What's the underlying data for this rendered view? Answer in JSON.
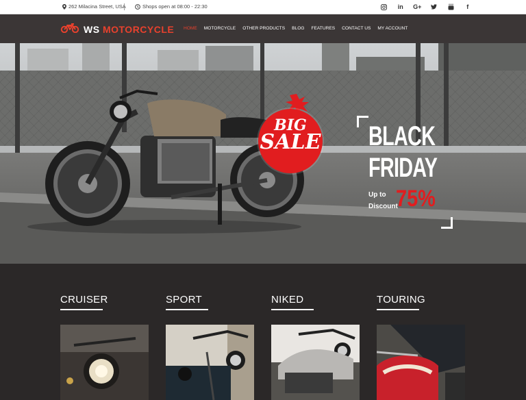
{
  "topbar": {
    "address": "262 Milacina Street, USA",
    "hours": "Shops open at 08:00 - 22:30",
    "socials": [
      {
        "name": "instagram",
        "glyph": "◎"
      },
      {
        "name": "linkedin",
        "glyph": "in"
      },
      {
        "name": "google-plus",
        "glyph": "G+"
      },
      {
        "name": "twitter",
        "glyph": "t"
      },
      {
        "name": "youtube",
        "glyph": "▶"
      },
      {
        "name": "facebook",
        "glyph": "f"
      }
    ]
  },
  "brand": {
    "name_part1": "WS",
    "name_part2": "MOTORCYCLE",
    "accent_color": "#e8412d"
  },
  "nav": {
    "items": [
      "HOME",
      "MOTORCYCLE",
      "OTHER PRODUCTS",
      "BLOG",
      "FEATURES",
      "CONTACT US",
      "MY ACCOUNT"
    ],
    "active_index": 0
  },
  "hero": {
    "badge_line1": "BIG",
    "badge_line2": "SALE",
    "headline_line1": "BLACK",
    "headline_line2": "FRIDAY",
    "upto": "Up to",
    "discount_label": "Discount",
    "discount_value": "75%",
    "sale_color": "#e11d1f"
  },
  "categories": [
    {
      "title": "CRUISER"
    },
    {
      "title": "SPORT"
    },
    {
      "title": "NIKED"
    },
    {
      "title": "TOURING"
    }
  ]
}
